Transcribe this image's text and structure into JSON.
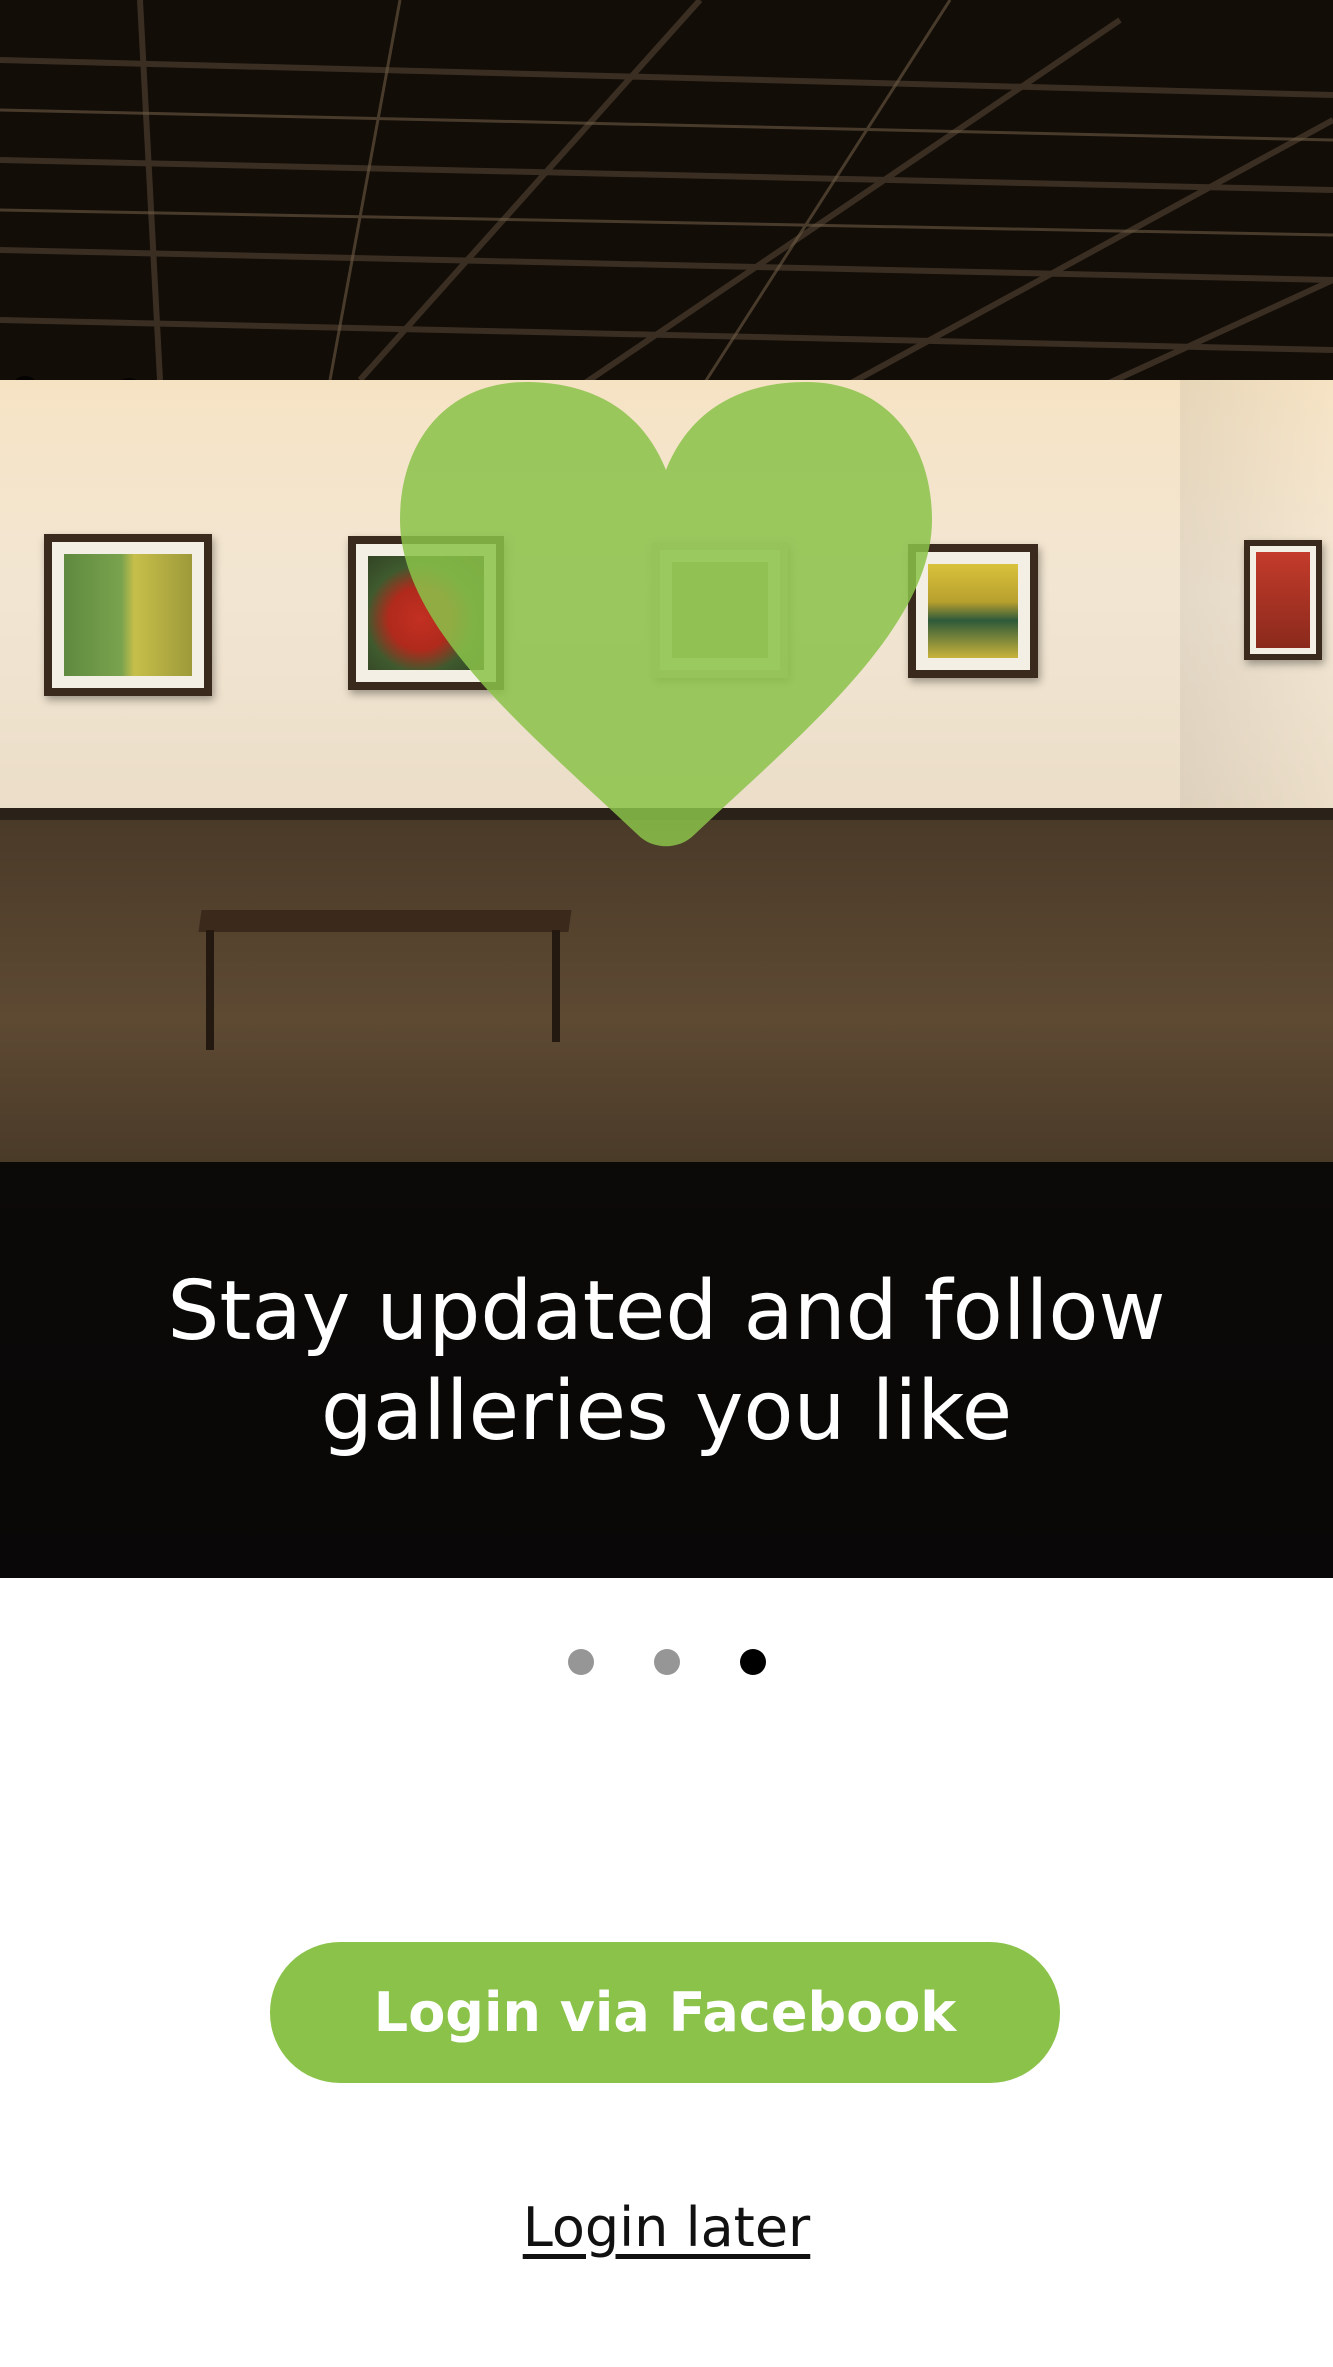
{
  "hero": {
    "caption_line1": "Stay updated and follow",
    "caption_line2": "galleries you like",
    "heart_color": "#8bc34a",
    "icon": "heart-icon"
  },
  "pager": {
    "count": 3,
    "active_index": 2
  },
  "actions": {
    "facebook_login_label": "Login via Facebook",
    "login_later_label": "Login later",
    "accent_color": "#8bc34a"
  }
}
